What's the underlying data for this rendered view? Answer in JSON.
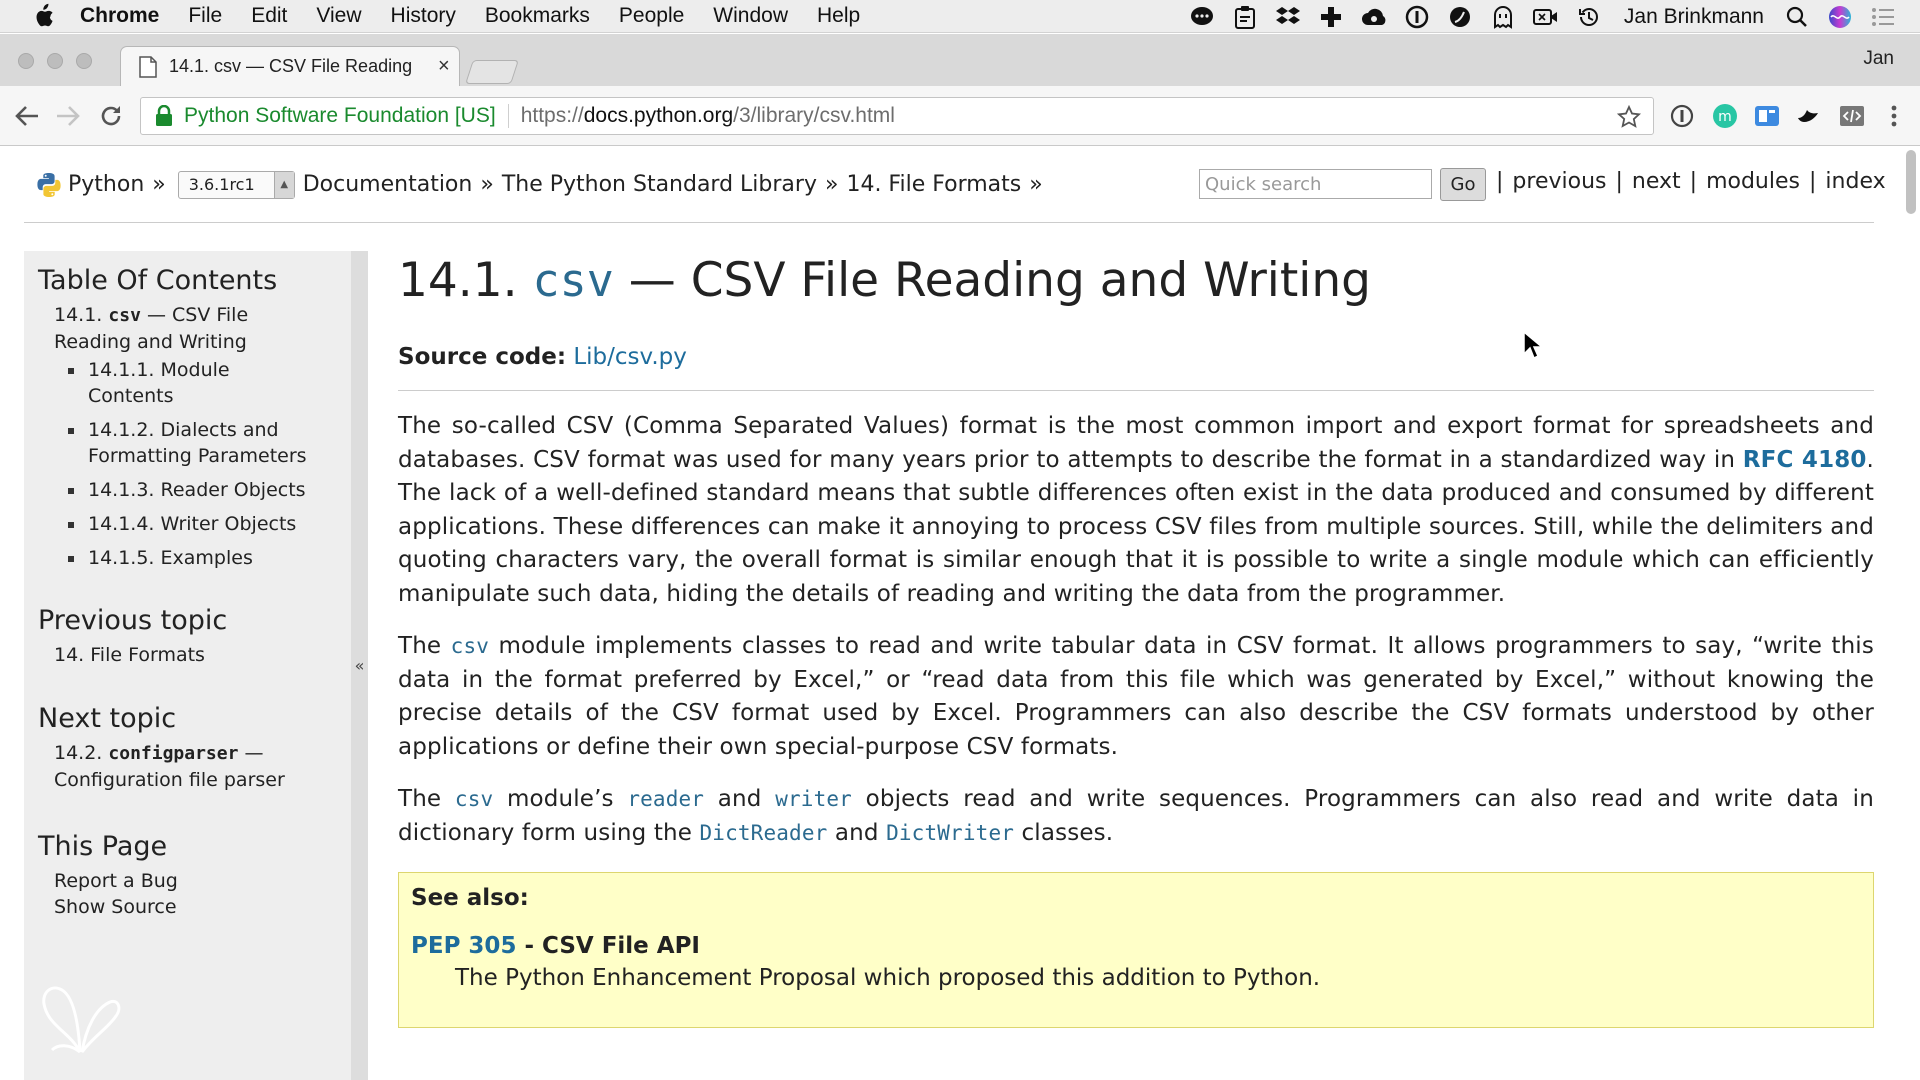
{
  "menubar": {
    "items": [
      "Chrome",
      "File",
      "Edit",
      "View",
      "History",
      "Bookmarks",
      "People",
      "Window",
      "Help"
    ],
    "username": "Jan Brinkmann"
  },
  "tab": {
    "title": "14.1. csv — CSV File Reading",
    "close": "×"
  },
  "profile": "Jan",
  "omnibox": {
    "org": "Python Software Foundation [US]",
    "scheme": "https://",
    "host": "docs.python.org",
    "path": "/3/library/csv.html"
  },
  "related": {
    "python": "Python",
    "version": "3.6.1rc1",
    "sep": "»",
    "crumbs": [
      "Documentation",
      "The Python Standard Library",
      "14. File Formats"
    ],
    "search_placeholder": "Quick search",
    "go": "Go",
    "nav": [
      "previous",
      "next",
      "modules",
      "index"
    ],
    "pipe": "|"
  },
  "sidebar": {
    "toc_heading": "Table Of Contents",
    "toc_main_prefix": "14.1. ",
    "toc_main_code": "csv",
    "toc_main_suffix": " — CSV File Reading and Writing",
    "toc_items": [
      "14.1.1. Module Contents",
      "14.1.2. Dialects and Formatting Parameters",
      "14.1.3. Reader Objects",
      "14.1.4. Writer Objects",
      "14.1.5. Examples"
    ],
    "prev_heading": "Previous topic",
    "prev_link": "14. File Formats",
    "next_heading": "Next topic",
    "next_prefix": "14.2. ",
    "next_code": "configparser",
    "next_suffix": " — Configuration file parser",
    "this_page_heading": "This Page",
    "this_page_links": [
      "Report a Bug",
      "Show Source"
    ],
    "collapse": "«"
  },
  "content": {
    "h1_prefix": "14.1. ",
    "h1_code": "csv",
    "h1_suffix": " — CSV File Reading and Writing",
    "source_label": "Source code:",
    "source_link": "Lib/csv.py",
    "p1_a": "The so-called CSV (Comma Separated Values) format is the most common import and export format for spreadsheets and databases. CSV format was used for many years prior to attempts to describe the format in a standardized way in ",
    "p1_link": "RFC 4180",
    "p1_b": ". The lack of a well-defined standard means that subtle differences often exist in the data produced and consumed by different applications. These differences can make it annoying to process CSV files from multiple sources. Still, while the delimiters and quoting characters vary, the overall format is similar enough that it is possible to write a single module which can efficiently manipulate such data, hiding the details of reading and writing the data from the programmer.",
    "p2_a": "The ",
    "p2_code": "csv",
    "p2_b": " module implements classes to read and write tabular data in CSV format. It allows programmers to say, “write this data in the format preferred by Excel,” or “read data from this file which was generated by Excel,” without knowing the precise details of the CSV format used by Excel. Programmers can also describe the CSV formats understood by other applications or define their own special-purpose CSV formats.",
    "p3_a": "The ",
    "p3_code1": "csv",
    "p3_b": " module’s ",
    "p3_code2": "reader",
    "p3_c": " and ",
    "p3_code3": "writer",
    "p3_d": " objects read and write sequences. Programmers can also read and write data in dictionary form using the ",
    "p3_code4": "DictReader",
    "p3_e": " and ",
    "p3_code5": "DictWriter",
    "p3_f": " classes.",
    "seealso_title": "See also:",
    "seealso_link": "PEP 305",
    "seealso_item_rest": " - CSV File API",
    "seealso_desc": "The Python Enhancement Proposal which proposed this addition to Python."
  }
}
